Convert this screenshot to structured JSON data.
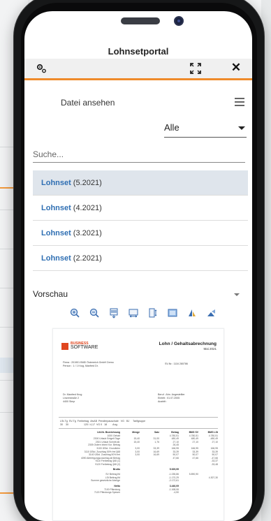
{
  "app": {
    "title": "Lohnsetportal"
  },
  "topbar": {
    "settings_icon": "settings-icon",
    "expand_icon": "expand-icon",
    "close_label": "✕"
  },
  "panel": {
    "title": "Datei ansehen",
    "menu_icon": "hamburger-icon",
    "filter": {
      "selected": "Alle"
    },
    "search": {
      "placeholder": "Suche..."
    },
    "files": [
      {
        "name": "Lohnset",
        "period": "(5.2021)",
        "active": true
      },
      {
        "name": "Lohnset",
        "period": "(4.2021)",
        "active": false
      },
      {
        "name": "Lohnset",
        "period": "(3.2021)",
        "active": false
      },
      {
        "name": "Lohnset",
        "period": "(2.2021)",
        "active": false
      }
    ]
  },
  "preview": {
    "label": "Vorschau",
    "tools": [
      "zoom-in-icon",
      "zoom-out-icon",
      "fit-page-icon",
      "fit-width-icon",
      "page-split-icon",
      "fullscreen-icon",
      "rotate-left-icon",
      "rotate-right-icon"
    ],
    "document": {
      "logo_line1": "BUSINESS",
      "logo_line2": "SOFTWARE",
      "heading": "Lohn / Gehaltsabrechnung",
      "month": "Mai 2021",
      "meta_left": [
        "Firma : 201901  BMD Österreich GmbH Demo",
        "Person : 1 / 1  Krug, Manfred Dr."
      ],
      "meta_right": "SV-Nr.: 1116 280786",
      "address": [
        "Dr. Manfred Krug",
        "Linzerstraße 2",
        "4400 Steyr"
      ],
      "address_right": [
        "Beruf : Ahn. Angestellter",
        "Eintritt : 01.07.2005",
        "Austritt :"
      ],
      "table_header": [
        "LSt-Tg",
        "SV-Tg",
        "Freibetrag",
        "AlvAB",
        "Pendlerpauschale",
        "VG",
        "BJ",
        "Tarifgruppe"
      ],
      "table_header_values": [
        "30",
        "30",
        "",
        "",
        "120 / 4,17",
        "VG 0",
        "18",
        "Ang."
      ],
      "columns": [
        "Lfd.Nr. Bezeichnung",
        "Menge",
        "Satz",
        "Betrag",
        "BMG SV",
        "BMG LSt"
      ],
      "rows": [
        [
          "1000 Gehalt",
          "",
          "",
          "4.780,51",
          "4.780,51",
          "4.780,51"
        ],
        [
          "2300 Urlaub Entgelt Tage",
          "15,40",
          "31,00",
          "480,49",
          "480,49",
          "-480,49"
        ],
        [
          "2301 Urlaub Schnitt alt.",
          "15,40",
          "1,76",
          "27,10",
          "27,10",
          "27,10"
        ],
        [
          "2305 Ostern Intent Kor. Betrag",
          "",
          "",
          "26,45",
          "",
          ""
        ],
        [
          "3100 ÜStd. Grundlohn",
          "3,00",
          "33,39",
          "166,95",
          "166,95",
          "166,95"
        ],
        [
          "3110 ÜStd. Zuschlag 50% frei §68",
          "3,00",
          "16,69",
          "33,39",
          "33,39",
          "33,39"
        ],
        [
          "3140 ÜStd. Zuschlag 50% frei",
          "3,00",
          "16,69",
          "50,07",
          "50,07",
          "50,07"
        ],
        [
          "4090 Abfertigungszuschlag alt Betrag",
          "",
          "",
          "47,66",
          "47,66",
          "-47,66"
        ],
        [
          "9110 Freibetrag §68 (1)",
          "",
          "",
          "",
          "",
          "-33,37"
        ],
        [
          "9120 Freibetrag §68 (2)",
          "",
          "",
          "",
          "",
          "-33,48"
        ]
      ],
      "brutto_label": "Brutto",
      "brutto_value": "5.929,99",
      "deductions": [
        [
          "SV Beitrag lfd",
          "",
          "",
          "-1.035,86",
          "5.890,90",
          ""
        ],
        [
          "LSt Beitrag lfd",
          "",
          "",
          "-1.170,29",
          "",
          "4.307,30"
        ],
        [
          "Summe gesetzliche Abzüge",
          "",
          "",
          "-2.172,61",
          "",
          ""
        ]
      ],
      "netto_label": "Netto",
      "netto_value": "3.440,09",
      "tail_rows": [
        [
          "7100 Pfändung",
          "",
          "",
          "-1.168,06",
          "",
          ""
        ],
        [
          "7120 Pfändungs Spesen",
          "",
          "",
          "-4,50",
          "",
          ""
        ]
      ]
    }
  },
  "colors": {
    "accent": "#ef8a2a",
    "link": "#2f6fb3",
    "active_row": "#dfe5ec"
  }
}
